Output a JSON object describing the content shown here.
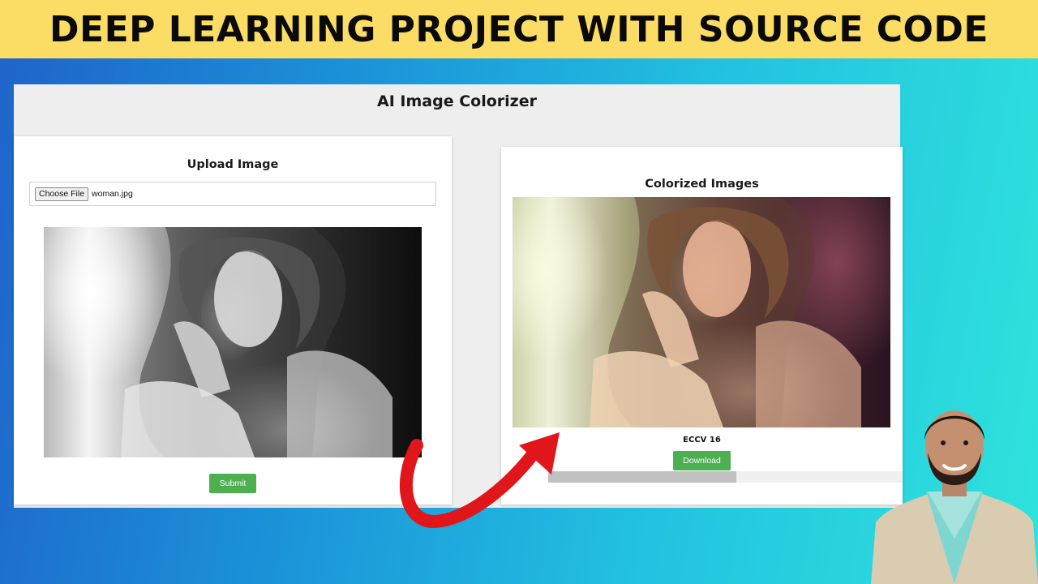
{
  "banner": {
    "title": "DEEP LEARNING PROJECT WITH SOURCE CODE",
    "background_color": "#fbdd65"
  },
  "app": {
    "title": "AI Image Colorizer",
    "upload": {
      "heading": "Upload Image",
      "choose_file_label": "Choose File",
      "file_name": "woman.jpg",
      "submit_label": "Submit"
    },
    "results": {
      "heading": "Colorized Images",
      "model_label": "ECCV 16",
      "download_label": "Download",
      "scrollbar_position": 0.53
    },
    "accent_color": "#4caf50"
  },
  "overlay": {
    "arrow_color": "#e0161b",
    "presenter_icon": "presenter-avatar"
  }
}
